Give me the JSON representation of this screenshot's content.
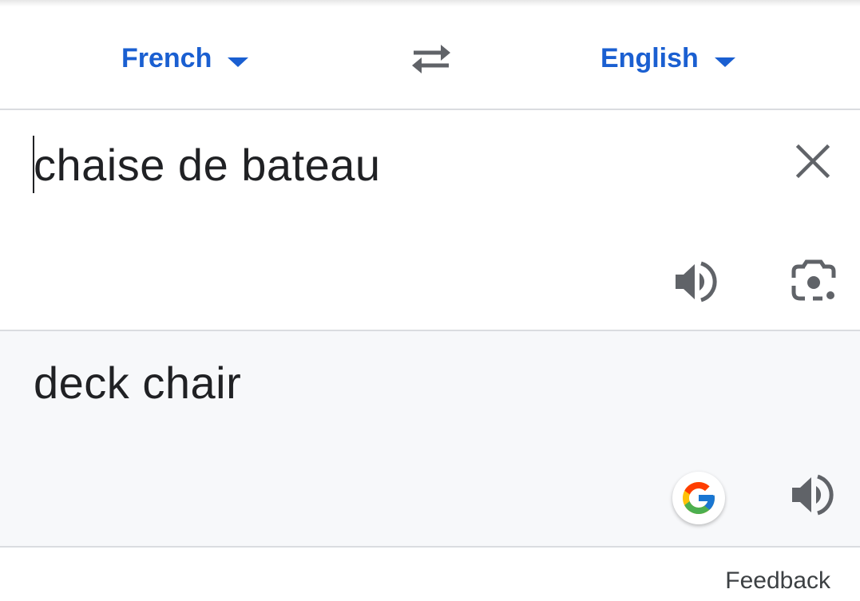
{
  "languages": {
    "source": "French",
    "target": "English"
  },
  "source": {
    "text": "chaise de bateau"
  },
  "translation": {
    "text": "deck chair"
  },
  "footer": {
    "feedback": "Feedback"
  },
  "icons": {
    "swap": "swap-languages-icon",
    "clear": "close-icon",
    "speaker": "volume-icon",
    "camera": "camera-lens-icon",
    "google": "google-logo-icon"
  },
  "colors": {
    "accent": "#1a5fd1",
    "text": "#202124",
    "icon": "#606368",
    "target_panel_bg": "#f7f8fa",
    "divider": "#dadce0"
  }
}
